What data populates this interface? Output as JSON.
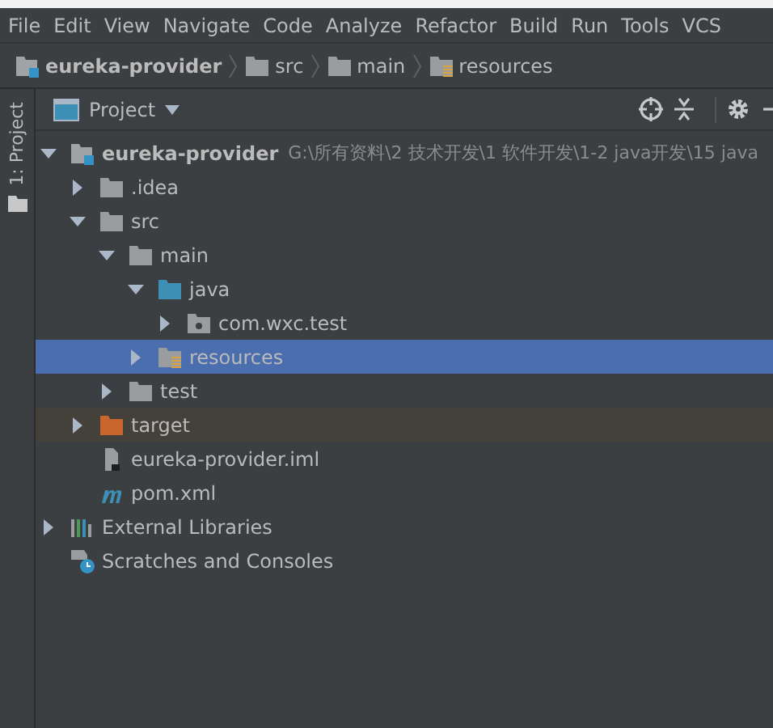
{
  "menu": [
    "File",
    "Edit",
    "View",
    "Navigate",
    "Code",
    "Analyze",
    "Refactor",
    "Build",
    "Run",
    "Tools",
    "VCS"
  ],
  "breadcrumbs": [
    {
      "label": "eureka-provider",
      "kind": "module"
    },
    {
      "label": "src",
      "kind": "folder"
    },
    {
      "label": "main",
      "kind": "folder"
    },
    {
      "label": "resources",
      "kind": "resources-folder"
    }
  ],
  "tool_strip": {
    "label": "1: Project"
  },
  "panel": {
    "title": "Project"
  },
  "tree": [
    {
      "label": "eureka-provider",
      "path": "G:\\所有资料\\2 技术开发\\1 软件开发\\1-2 java开发\\15 java",
      "kind": "module",
      "expanded": true,
      "selected": false,
      "children": [
        {
          "label": ".idea",
          "kind": "folder",
          "expanded": false,
          "selected": false
        },
        {
          "label": "src",
          "kind": "folder",
          "expanded": true,
          "selected": false,
          "children": [
            {
              "label": "main",
              "kind": "folder",
              "expanded": true,
              "selected": false,
              "children": [
                {
                  "label": "java",
                  "kind": "source-folder",
                  "expanded": true,
                  "selected": false,
                  "children": [
                    {
                      "label": "com.wxc.test",
                      "kind": "package",
                      "expanded": false,
                      "selected": false
                    }
                  ]
                },
                {
                  "label": "resources",
                  "kind": "resources-folder",
                  "expanded": false,
                  "selected": true
                }
              ]
            },
            {
              "label": "test",
              "kind": "folder",
              "expanded": false,
              "selected": false
            }
          ]
        },
        {
          "label": "target",
          "kind": "excluded-folder",
          "expanded": false,
          "selected": false
        },
        {
          "label": "eureka-provider.iml",
          "kind": "iml-file",
          "selected": false
        },
        {
          "label": "pom.xml",
          "kind": "maven-file",
          "selected": false
        }
      ]
    },
    {
      "label": "External Libraries",
      "kind": "libraries",
      "expanded": false,
      "selected": false
    },
    {
      "label": "Scratches and Consoles",
      "kind": "scratches",
      "selected": false
    }
  ]
}
